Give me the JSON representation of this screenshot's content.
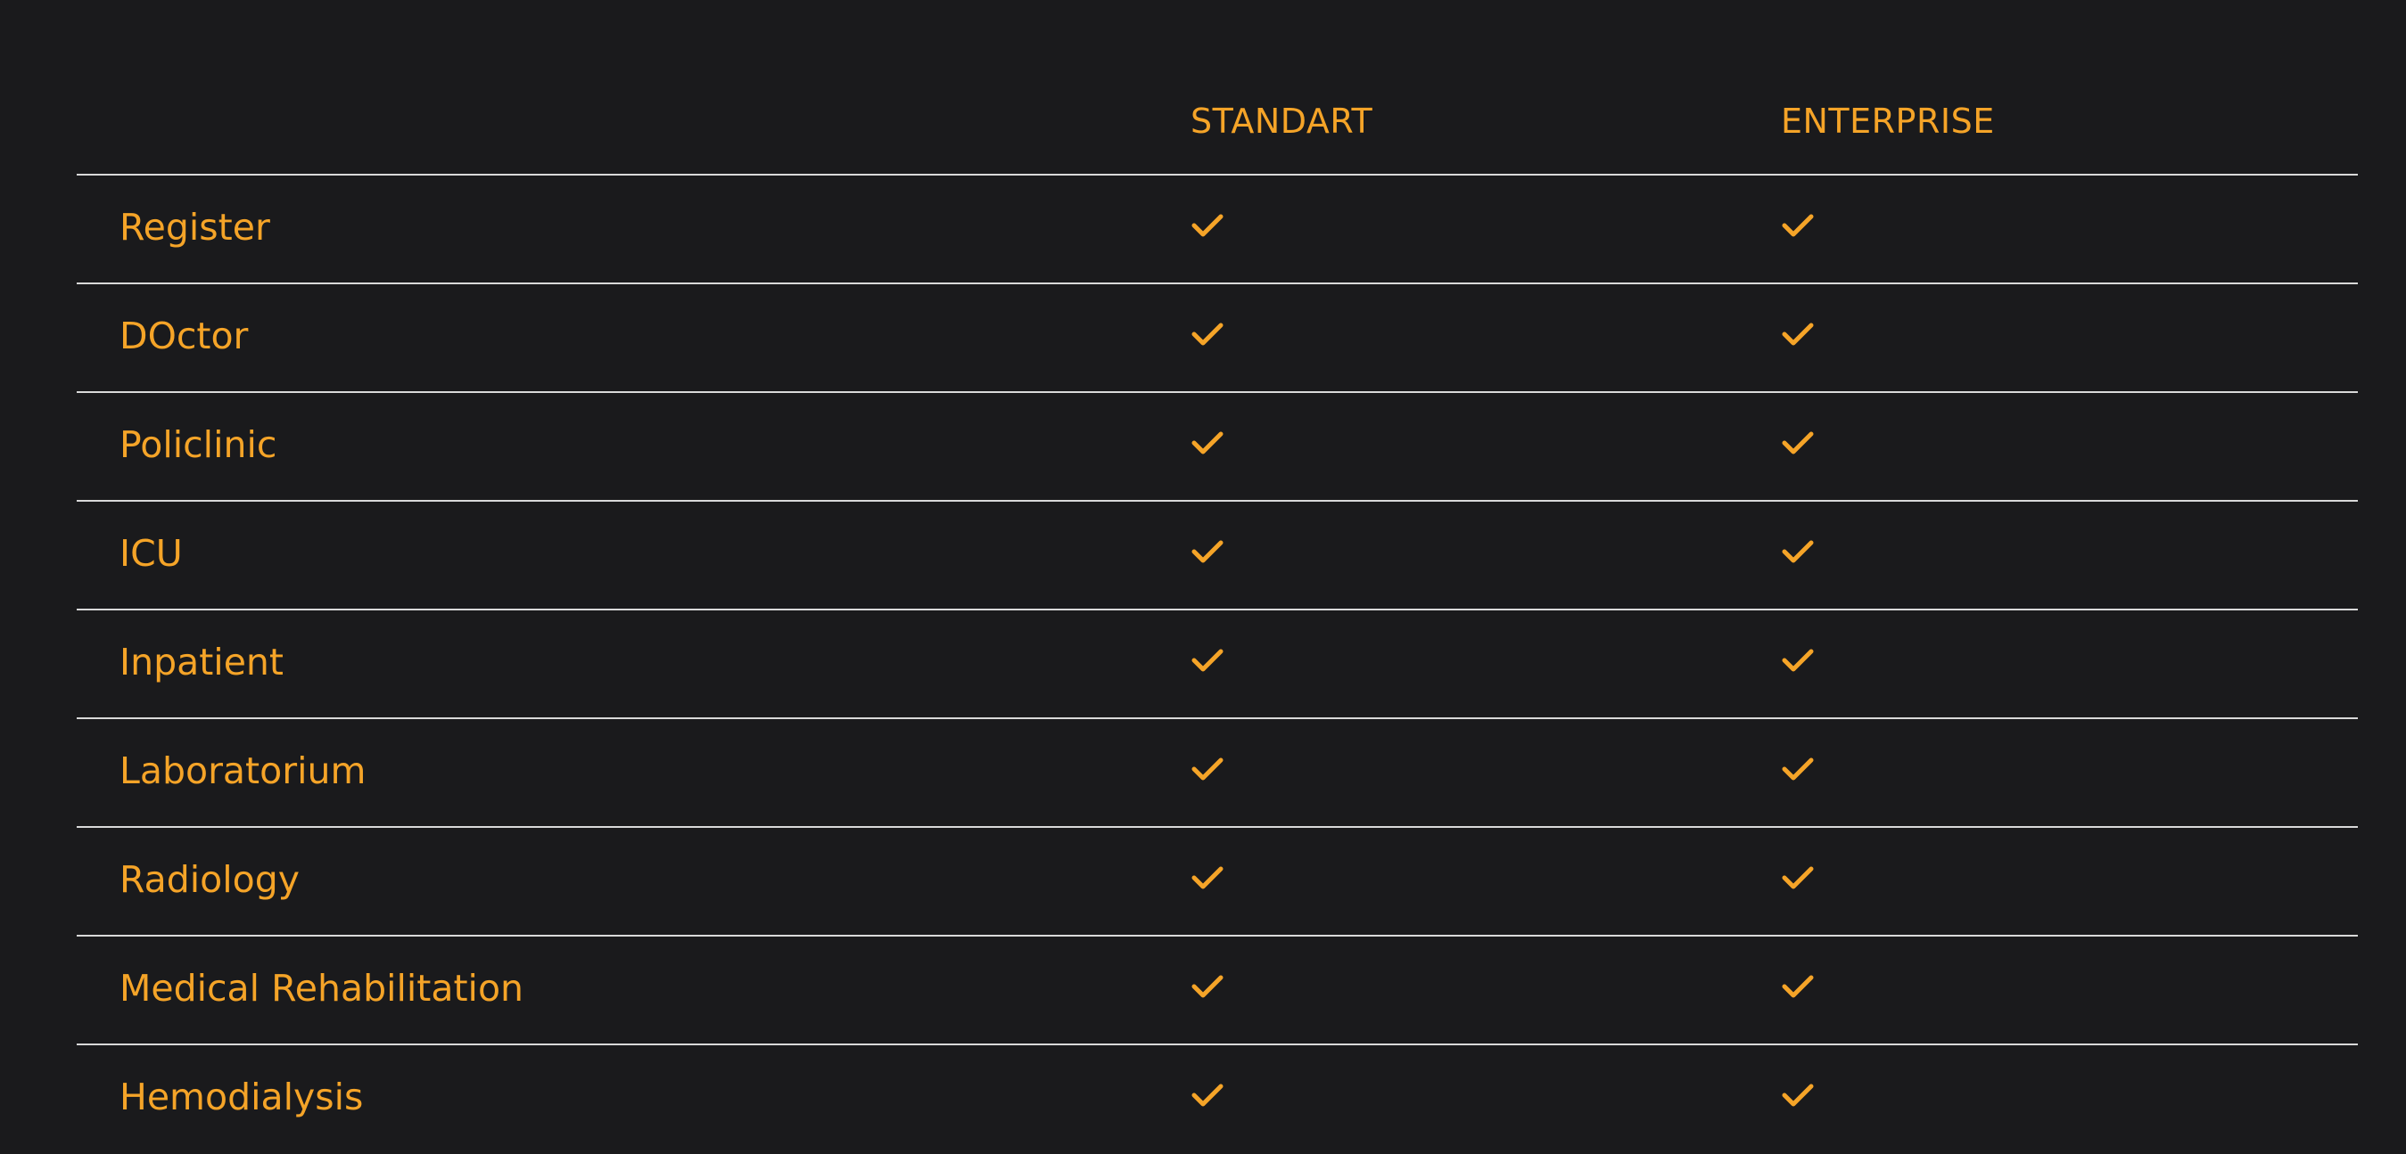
{
  "table": {
    "columns": [
      "STANDART",
      "ENTERPRISE"
    ],
    "rows": [
      {
        "feature": "Register",
        "standart": true,
        "enterprise": true
      },
      {
        "feature": "DOctor",
        "standart": true,
        "enterprise": true
      },
      {
        "feature": "Policlinic",
        "standart": true,
        "enterprise": true
      },
      {
        "feature": "ICU",
        "standart": true,
        "enterprise": true
      },
      {
        "feature": "Inpatient",
        "standart": true,
        "enterprise": true
      },
      {
        "feature": "Laboratorium",
        "standart": true,
        "enterprise": true
      },
      {
        "feature": "Radiology",
        "standart": true,
        "enterprise": true
      },
      {
        "feature": "Medical Rehabilitation",
        "standart": true,
        "enterprise": true
      },
      {
        "feature": "Hemodialysis",
        "standart": true,
        "enterprise": true
      }
    ]
  },
  "icons": {
    "included": "check-icon"
  },
  "colors": {
    "accent": "#f5a428",
    "background": "#1a1a1c",
    "divider": "#d9d9d9"
  }
}
